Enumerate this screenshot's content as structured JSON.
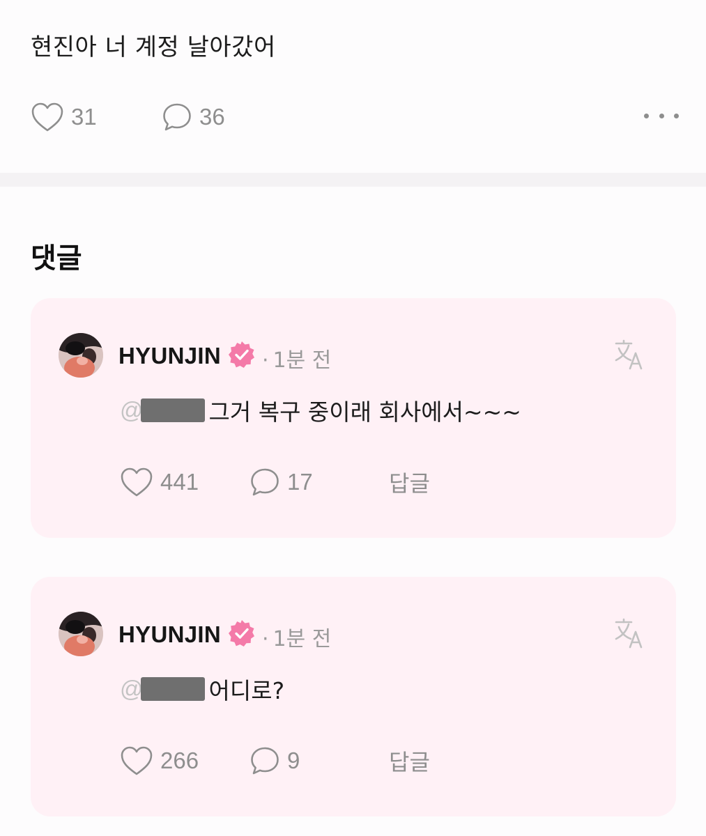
{
  "post": {
    "text": "현진아 너 계정 날아갔어",
    "likes": "31",
    "comments": "36",
    "more_icon": "more-horizontal-icon"
  },
  "comments_section": {
    "title": "댓글"
  },
  "comments": [
    {
      "username": "HYUNJIN",
      "verified_icon": "verified-badge-icon",
      "verified_color": "#f47aa8",
      "timestamp_dot": "·",
      "timestamp": "1분 전",
      "mention_at": "@",
      "text": "그거 복구 중이래 회사에서~~~",
      "likes": "441",
      "replies": "17",
      "reply_label": "답글",
      "translate_icon": "translate-icon"
    },
    {
      "username": "HYUNJIN",
      "verified_icon": "verified-badge-icon",
      "verified_color": "#f47aa8",
      "timestamp_dot": "·",
      "timestamp": "1분 전",
      "mention_at": "@",
      "text": "어디로?",
      "likes": "266",
      "replies": "9",
      "reply_label": "답글",
      "translate_icon": "translate-icon"
    }
  ],
  "colors": {
    "card_background": "#fff1f6",
    "muted_text": "#8e8e8e",
    "accent_pink": "#f47aa8"
  }
}
